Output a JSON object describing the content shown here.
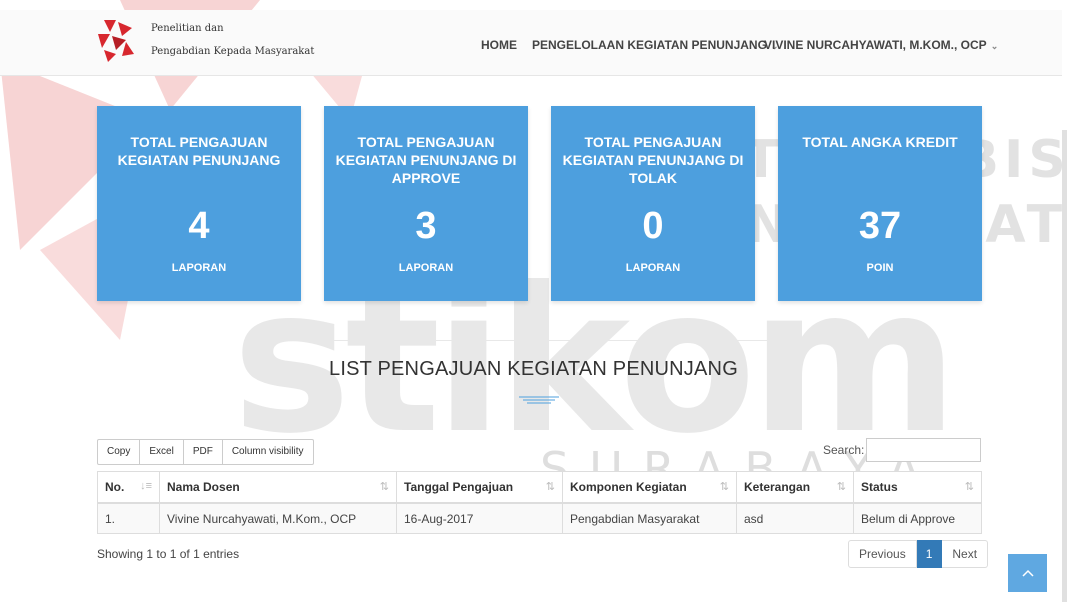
{
  "header": {
    "brand_line1": "Penelitian dan",
    "brand_line2": "Pengabdian Kepada Masyarakat",
    "nav": {
      "home": "HOME",
      "pengelolaan": "PENGELOLAAN KEGIATAN PENUNJANG",
      "user": "VIVINE NURCAHYAWATI, M.KOM., OCP"
    }
  },
  "cards": [
    {
      "title": "TOTAL PENGAJUAN KEGIATAN PENUNJANG",
      "value": "4",
      "unit": "LAPORAN"
    },
    {
      "title": "TOTAL PENGAJUAN KEGIATAN PENUNJANG DI APPROVE",
      "value": "3",
      "unit": "LAPORAN"
    },
    {
      "title": "TOTAL PENGAJUAN KEGIATAN PENUNJANG DI TOLAK",
      "value": "0",
      "unit": "LAPORAN"
    },
    {
      "title": "TOTAL ANGKA KREDIT",
      "value": "37",
      "unit": "POIN"
    }
  ],
  "list": {
    "title": "LIST PENGAJUAN KEGIATAN PENUNJANG",
    "buttons": {
      "copy": "Copy",
      "excel": "Excel",
      "pdf": "PDF",
      "colvis": "Column visibility"
    },
    "search_label": "Search:",
    "columns": [
      "No.",
      "Nama Dosen",
      "Tanggal Pengajuan",
      "Komponen Kegiatan",
      "Keterangan",
      "Status"
    ],
    "rows": [
      [
        "1.",
        "Vivine Nurcahyawati, M.Kom., OCP",
        "16-Aug-2017",
        "Pengabdian Masyarakat",
        "asd",
        "Belum di Approve"
      ]
    ],
    "info": "Showing 1 to 1 of 1 entries",
    "pagination": {
      "previous": "Previous",
      "page": "1",
      "next": "Next"
    }
  },
  "watermark": {
    "big": "stikom",
    "line1": "INSTITUT BISNIS",
    "line2": "DAN INFORMATIKA",
    "line3": "SURABAYA"
  },
  "colors": {
    "card_bg": "#4d9fde",
    "accent": "#337ab7",
    "logo_red": "#d7272e"
  }
}
